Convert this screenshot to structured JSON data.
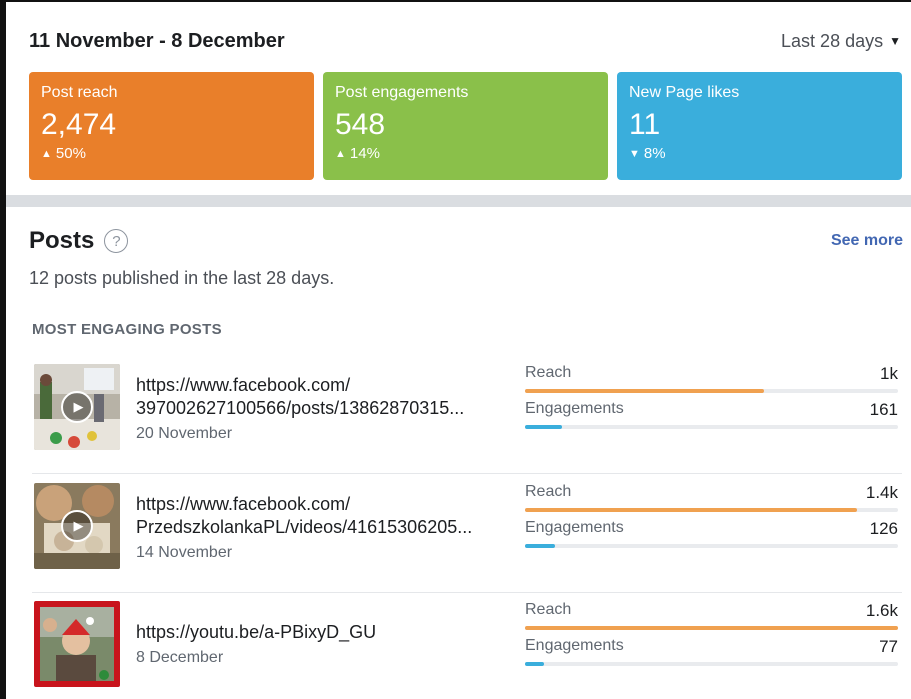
{
  "header": {
    "date_range": "11 November - 8 December",
    "period_label": "Last 28 days"
  },
  "cards": [
    {
      "title": "Post reach",
      "value": "2,474",
      "change": "50%",
      "direction": "up",
      "color": "#e97f2a"
    },
    {
      "title": "Post engagements",
      "value": "548",
      "change": "14%",
      "direction": "up",
      "color": "#8ac04a"
    },
    {
      "title": "New Page likes",
      "value": "11",
      "change": "8%",
      "direction": "down",
      "color": "#3aaedc"
    }
  ],
  "posts": {
    "title": "Posts",
    "see_more": "See more",
    "subtitle": "12 posts published in the last 28 days.",
    "section_label": "MOST ENGAGING POSTS",
    "reach_color": "#f0a150",
    "engagement_color": "#3aaedc",
    "items": [
      {
        "url_line1": "https://www.facebook.com/",
        "url_line2": "397002627100566/posts/13862870315...",
        "date": "20 November",
        "reach_label": "Reach",
        "reach_value": "1k",
        "reach_fraction": 0.64,
        "engagements_label": "Engagements",
        "engagements_value": "161",
        "engagements_fraction": 0.1,
        "video": true,
        "thumb_icon": "video-thumbnail-icon"
      },
      {
        "url_line1": "https://www.facebook.com/",
        "url_line2": "PrzedszkolankaPL/videos/41615306205...",
        "date": "14 November",
        "reach_label": "Reach",
        "reach_value": "1.4k",
        "reach_fraction": 0.89,
        "engagements_label": "Engagements",
        "engagements_value": "126",
        "engagements_fraction": 0.08,
        "video": true,
        "thumb_icon": "video-thumbnail-icon"
      },
      {
        "url_line1": "https://youtu.be/a-PBixyD_GU",
        "url_line2": "",
        "date": "8 December",
        "reach_label": "Reach",
        "reach_value": "1.6k",
        "reach_fraction": 1.0,
        "engagements_label": "Engagements",
        "engagements_value": "77",
        "engagements_fraction": 0.05,
        "video": false,
        "thumb_icon": "image-thumbnail-icon"
      }
    ]
  }
}
